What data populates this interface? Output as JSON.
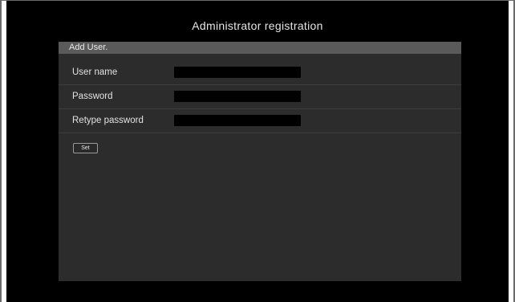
{
  "page": {
    "title": "Administrator registration"
  },
  "panel": {
    "header": "Add User."
  },
  "form": {
    "fields": [
      {
        "label": "User name",
        "value": ""
      },
      {
        "label": "Password",
        "value": ""
      },
      {
        "label": "Retype password",
        "value": ""
      }
    ],
    "set_label": "Set"
  },
  "colors": {
    "background": "#000000",
    "panel": "#2c2c2c",
    "panel_header": "#5a5a5a",
    "input": "#000000",
    "text": "#e6e6e6"
  }
}
